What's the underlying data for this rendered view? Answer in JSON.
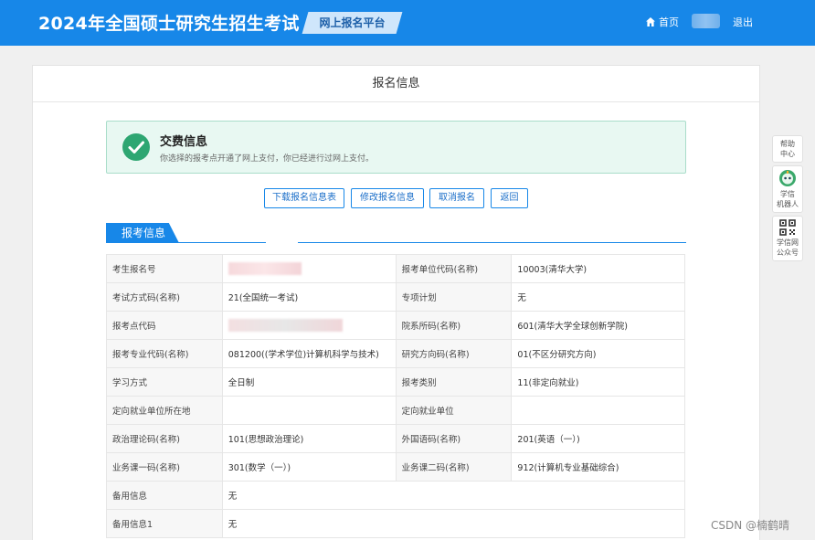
{
  "header": {
    "title": "2024年全国硕士研究生招生考试",
    "platform_badge": "网上报名平台",
    "nav_home": "首页",
    "nav_logout": "退出"
  },
  "card": {
    "title": "报名信息"
  },
  "notice": {
    "title": "交费信息",
    "text": "你选择的报考点开通了网上支付，你已经进行过网上支付。"
  },
  "actions": [
    {
      "label": "下载报名信息表"
    },
    {
      "label": "修改报名信息"
    },
    {
      "label": "取消报名"
    },
    {
      "label": "返回"
    }
  ],
  "section": {
    "title": "报考信息"
  },
  "table": {
    "rows": [
      {
        "label1": "考生报名号",
        "value1": "",
        "label2": "报考单位代码(名称)",
        "value2": "10003(清华大学)"
      },
      {
        "label1": "考试方式码(名称)",
        "value1": "21(全国统一考试)",
        "label2": "专项计划",
        "value2": "无"
      },
      {
        "label1": "报考点代码",
        "value1": "",
        "label2": "院系所码(名称)",
        "value2": "601(清华大学全球创新学院)"
      },
      {
        "label1": "报考专业代码(名称)",
        "value1": "081200((学术学位)计算机科学与技术)",
        "label2": "研究方向码(名称)",
        "value2": "01(不区分研究方向)"
      },
      {
        "label1": "学习方式",
        "value1": "全日制",
        "label2": "报考类别",
        "value2": "11(非定向就业)"
      },
      {
        "label1": "定向就业单位所在地",
        "value1": "",
        "label2": "定向就业单位",
        "value2": ""
      },
      {
        "label1": "政治理论码(名称)",
        "value1": "101(思想政治理论)",
        "label2": "外国语码(名称)",
        "value2": "201(英语（一）)"
      },
      {
        "label1": "业务课一码(名称)",
        "value1": "301(数学（一）)",
        "label2": "业务课二码(名称)",
        "value2": "912(计算机专业基础综合)"
      },
      {
        "label1": "备用信息",
        "value_full": "无"
      },
      {
        "label1": "备用信息1",
        "value_full": "无"
      }
    ]
  },
  "side_panel": {
    "help_line1": "帮助",
    "help_line2": "中心",
    "robot_line1": "学信",
    "robot_line2": "机器人",
    "wechat_line1": "学信网",
    "wechat_line2": "公众号"
  },
  "watermark": "CSDN @楠鹤晴",
  "colors": {
    "brand_blue": "#1787e8",
    "success_green": "#2ea672",
    "notice_bg": "#e8f8f2"
  }
}
